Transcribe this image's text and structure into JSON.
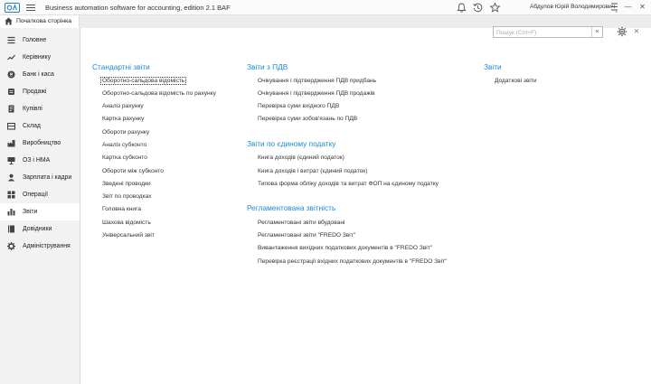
{
  "titlebar": {
    "app_title": "Business automation software for accounting, edition 2.1 BAF",
    "user_name": "Абдулов Юрій Володимирович",
    "icons": [
      "bell-icon",
      "history-icon",
      "star-icon"
    ]
  },
  "tabs": {
    "home_label": "Початкова сторінка"
  },
  "sidebar": {
    "items": [
      {
        "label": "Головне",
        "icon": "menu-lines-icon"
      },
      {
        "label": "Керівнику",
        "icon": "trend-icon"
      },
      {
        "label": "Банк і каса",
        "icon": "coin-icon"
      },
      {
        "label": "Продажі",
        "icon": "cart-icon"
      },
      {
        "label": "Купівлі",
        "icon": "receipt-icon"
      },
      {
        "label": "Склад",
        "icon": "warehouse-icon"
      },
      {
        "label": "Виробництво",
        "icon": "factory-icon"
      },
      {
        "label": "ОЗ і НМА",
        "icon": "asset-icon"
      },
      {
        "label": "Зарплата і кадри",
        "icon": "people-icon"
      },
      {
        "label": "Операції",
        "icon": "operations-icon"
      },
      {
        "label": "Звіти",
        "icon": "bar-chart-icon"
      },
      {
        "label": "Довідники",
        "icon": "book-icon"
      },
      {
        "label": "Адміністрування",
        "icon": "gear-icon"
      }
    ],
    "active_index": 10
  },
  "main": {
    "search_placeholder": "Пошук (Ctrl+F)",
    "col1": {
      "title": "Стандартні звіти",
      "links": [
        "Оборотно-сальдова відомість",
        "Оборотно-сальдова відомість по рахунку",
        "Аналіз рахунку",
        "Картка рахунку",
        "Обороти рахунку",
        "Аналіз субконто",
        "Картка субконто",
        "Обороти між субконто",
        "Зведені проводки",
        "Звіт по проводках",
        "Головна книга",
        "Шахова відомість",
        "Універсальний звіт"
      ]
    },
    "col2": {
      "sections": [
        {
          "title": "Звіти з ПДВ",
          "links": [
            "Очікування і підтвердження ПДВ придбань",
            "Очікування і підтвердження ПДВ продажів",
            "Перевірка суми вхідного ПДВ",
            "Перевірка суми зобов'язань по ПДВ"
          ]
        },
        {
          "title": "Звіти по єдиному податку",
          "links": [
            "Книга доходів (єдиний податок)",
            "Книга доходів і витрат (єдиний податок)",
            "Типова форма обліку доходів та витрат ФОП на єдиному податку"
          ]
        },
        {
          "title": "Регламентована звітність",
          "links": [
            "Регламентовані звіти вбудовані",
            "Регламентовані звіти \"FREDO Звіт\"",
            "Вивантаження вихідних податкових документів в \"FREDO Звіт\"",
            "Перевірка реєстрації вхідних податкових документів в \"FREDO Звіт\""
          ]
        }
      ]
    },
    "col3": {
      "title": "Звіти",
      "links": [
        "Додаткові звіти"
      ]
    }
  }
}
